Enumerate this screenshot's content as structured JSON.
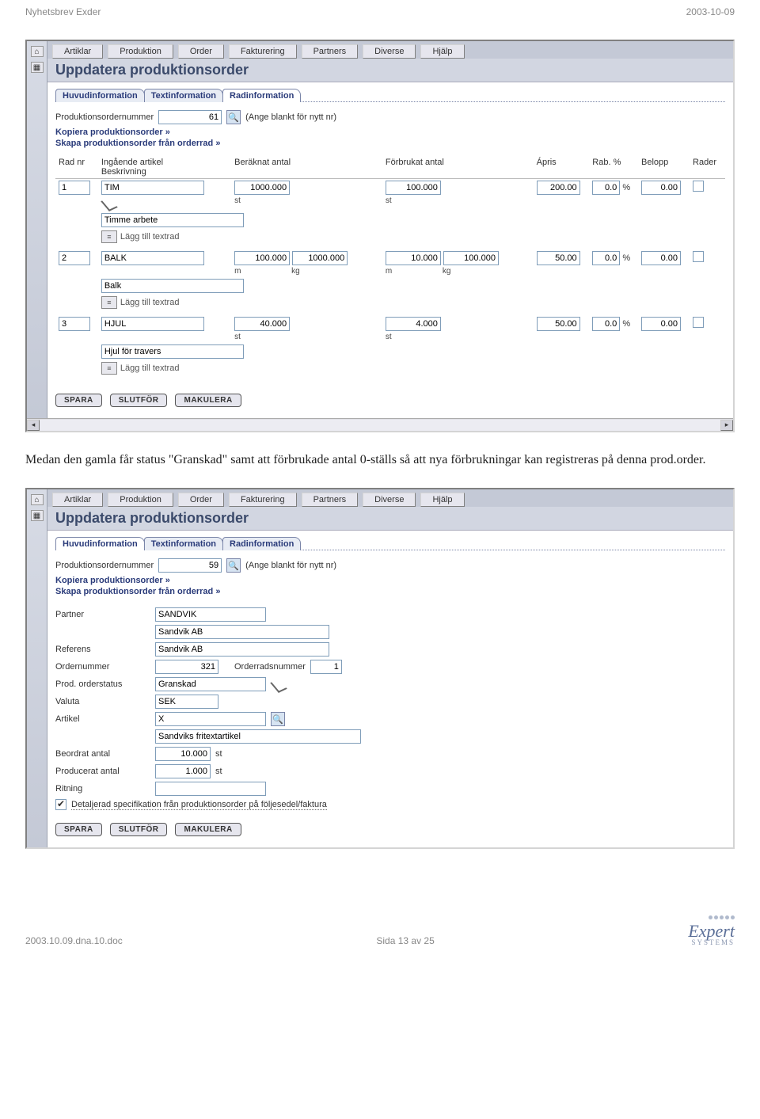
{
  "doc_header": {
    "left": "Nyhetsbrev Exder",
    "right": "2003-10-09"
  },
  "menu": {
    "items": [
      "Artiklar",
      "Produktion",
      "Order",
      "Fakturering",
      "Partners",
      "Diverse",
      "Hjälp"
    ]
  },
  "page_title": "Uppdatera produktionsorder",
  "tabs": {
    "items": [
      "Huvudinformation",
      "Textinformation",
      "Radinformation"
    ]
  },
  "shot1": {
    "active_tab": 2,
    "pono_label": "Produktionsordernummer",
    "pono_value": "61",
    "pono_hint": "(Ange blankt för nytt nr)",
    "link_copy": "Kopiera produktionsorder »",
    "link_create": "Skapa produktionsorder från orderrad »",
    "columns": {
      "radnr": "Rad nr",
      "artikel": "Ingående artikel",
      "beskriv": "Beskrivning",
      "beraknat": "Beräknat antal",
      "forbrukat": "Förbrukat antal",
      "apris": "Ápris",
      "rabatt": "Rab. %",
      "belopp": "Belopp",
      "radera": "Rader"
    },
    "rows": [
      {
        "nr": "1",
        "artikel": "TIM",
        "ber1": "1000.000",
        "ber_u1": "st",
        "for1": "100.000",
        "for_u1": "st",
        "apris": "200.00",
        "rab": "0.0",
        "belopp": "0.00",
        "desc": "Timme arbete",
        "textrad": "Lägg till textrad"
      },
      {
        "nr": "2",
        "artikel": "BALK",
        "ber1": "100.000",
        "ber_u1": "m",
        "ber2": "1000.000",
        "ber_u2": "kg",
        "for1": "10.000",
        "for_u1": "m",
        "for2": "100.000",
        "for_u2": "kg",
        "apris": "50.00",
        "rab": "0.0",
        "belopp": "0.00",
        "desc": "Balk",
        "textrad": "Lägg till textrad"
      },
      {
        "nr": "3",
        "artikel": "HJUL",
        "ber1": "40.000",
        "ber_u1": "st",
        "for1": "4.000",
        "for_u1": "st",
        "apris": "50.00",
        "rab": "0.0",
        "belopp": "0.00",
        "desc": "Hjul för travers",
        "textrad": "Lägg till textrad"
      }
    ],
    "buttons": {
      "spara": "SPARA",
      "slutfor": "SLUTFÖR",
      "makulera": "MAKULERA"
    },
    "rab_suffix": "%"
  },
  "between_text": "Medan den gamla får status \"Granskad\" samt att förbrukade antal 0-ställs så att nya förbrukningar kan registreras på denna prod.order.",
  "shot2": {
    "active_tab": 0,
    "pono_value": "59",
    "pono_hint": "(Ange blankt för nytt nr)",
    "link_copy": "Kopiera produktionsorder »",
    "link_create": "Skapa produktionsorder från orderrad »",
    "labels": {
      "partner": "Partner",
      "referens": "Referens",
      "ordernummer": "Ordernummer",
      "orderradsnummer": "Orderradsnummer",
      "prodstatus": "Prod. orderstatus",
      "valuta": "Valuta",
      "artikel": "Artikel",
      "beordrat": "Beordrat antal",
      "producerat": "Producerat antal",
      "ritning": "Ritning",
      "spec_chk": "Detaljerad specifikation från produktionsorder på följesedel/faktura"
    },
    "values": {
      "partner_code": "SANDVIK",
      "partner_name": "Sandvik AB",
      "referens": "Sandvik AB",
      "ordernummer": "321",
      "orderradsnummer": "1",
      "prodstatus": "Granskad",
      "valuta": "SEK",
      "artikel_code": "X",
      "artikel_name": "Sandviks fritextartikel",
      "beordrat": "10.000",
      "beordrat_unit": "st",
      "producerat": "1.000",
      "producerat_unit": "st",
      "ritning": ""
    }
  },
  "footer": {
    "file": "2003.10.09.dna.10.doc",
    "page": "Sida 13 av 25",
    "brand": "Expert",
    "brand_sub": "SYSTEMS"
  }
}
